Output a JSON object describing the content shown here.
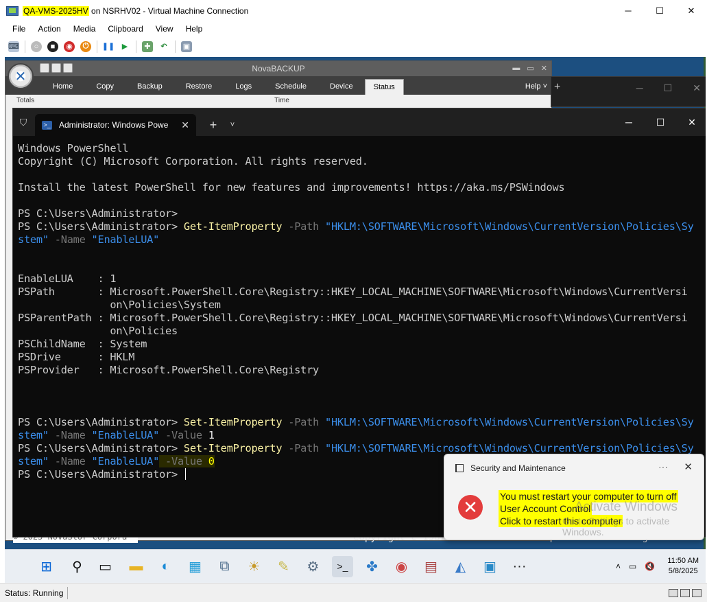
{
  "vm_window": {
    "title_highlight": "QA-VMS-2025HV",
    "title_rest": " on NSRHV02 - Virtual Machine Connection",
    "controls": [
      "─",
      "☐",
      "✕"
    ],
    "menu": [
      "File",
      "Action",
      "Media",
      "Clipboard",
      "View",
      "Help"
    ],
    "status": "Status: Running"
  },
  "nova": {
    "title": "NovaBACKUP",
    "tabs": [
      "Home",
      "Copy",
      "Backup",
      "Restore",
      "Logs",
      "Schedule",
      "Device",
      "Status"
    ],
    "active_tab": "Status",
    "help": "Help ˅",
    "body_left": "Totals",
    "body_right": "Time",
    "copyright": "Copyright c 1987-2025 NovaStor Corporation. All rights re",
    "left_strip": "© 2025 NovaStor Corpora"
  },
  "terminal": {
    "tab_title": "Administrator: Windows Powe",
    "new_tab": "+",
    "dropdown": "˅",
    "controls": [
      "─",
      "☐",
      "✕"
    ],
    "lines": {
      "l1": "Windows PowerShell",
      "l2": "Copyright (C) Microsoft Corporation. All rights reserved.",
      "l4": "Install the latest PowerShell for new features and improvements! https://aka.ms/PSWindows",
      "prompt": "PS C:\\Users\\Administrator> ",
      "prompt_bare": "PS C:\\Users\\Administrator>",
      "get_cmd": "Get-ItemProperty",
      "set_cmd": "Set-ItemProperty",
      "path_param": " -Path ",
      "path_val_a": "\"HKLM:\\SOFTWARE\\Microsoft\\Windows\\CurrentVersion\\Policies\\Sy",
      "path_val_b": "stem\"",
      "name_param": " -Name ",
      "name_val": "\"EnableLUA\"",
      "value_param": " -Value ",
      "value_1": "1",
      "value_0": "0",
      "prop1": "EnableLUA    : 1",
      "prop2": "PSPath       : Microsoft.PowerShell.Core\\Registry::HKEY_LOCAL_MACHINE\\SOFTWARE\\Microsoft\\Windows\\CurrentVersi",
      "prop2b": "               on\\Policies\\System",
      "prop3": "PSParentPath : Microsoft.PowerShell.Core\\Registry::HKEY_LOCAL_MACHINE\\SOFTWARE\\Microsoft\\Windows\\CurrentVersi",
      "prop3b": "               on\\Policies",
      "prop4": "PSChildName  : System",
      "prop5": "PSDrive      : HKLM",
      "prop6": "PSProvider   : Microsoft.PowerShell.Core\\Registry"
    }
  },
  "toast": {
    "app": "Security and Maintenance",
    "more": "···",
    "close": "✕",
    "line1": "You must restart your computer to turn off",
    "line2": "User Account Control",
    "line3": "Click to restart this computer",
    "watermark1": "Activate Windows",
    "watermark2": "Go to Settings to activate Windows."
  },
  "taskbar": {
    "time": "11:50 AM",
    "date": "5/8/2025",
    "tray_up": "˄"
  },
  "colors": {
    "terminal_bg": "#0c0c0c",
    "cmdlet": "#f9f1a5",
    "string": "#3b8eea",
    "param": "#767676",
    "highlight": "#ffff00",
    "toast_error": "#e33c3c"
  }
}
